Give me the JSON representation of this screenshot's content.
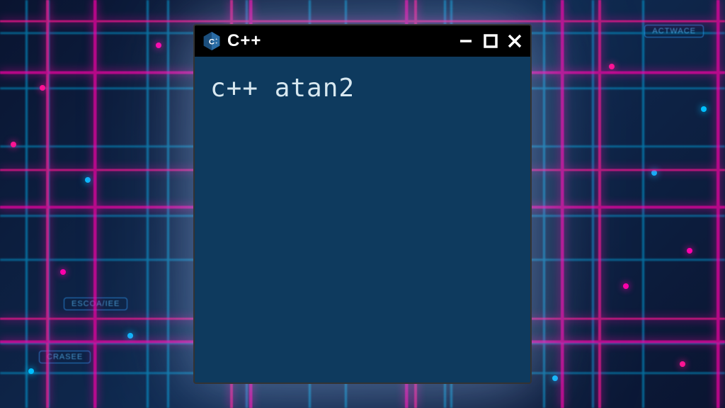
{
  "window": {
    "title": "C++",
    "icon_name": "cpp-icon",
    "content_text": "c++ atan2"
  },
  "controls": {
    "minimize": "minimize",
    "maximize": "maximize",
    "close": "close"
  },
  "background": {
    "badges": [
      "ACTWACE",
      "CRASEE",
      "ESCOA/IEE"
    ]
  },
  "colors": {
    "window_bg": "#0e3a5e",
    "titlebar_bg": "#000000",
    "text": "#d8e8f0",
    "accent_cyan": "#00bfff",
    "accent_magenta": "#ff00aa"
  }
}
